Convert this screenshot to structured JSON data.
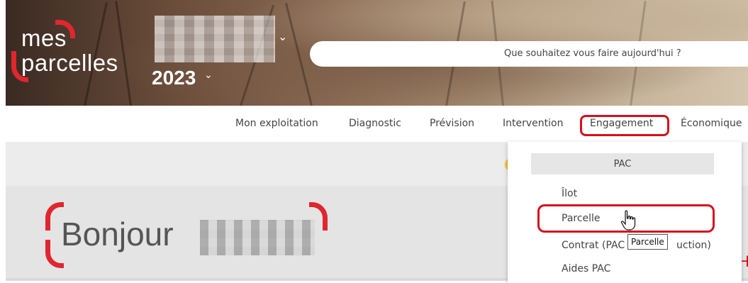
{
  "brand": {
    "line1": "mes",
    "line2": "parcelles",
    "accent": "#e0262f"
  },
  "header": {
    "farm_chevron": "⌄",
    "year": "2023",
    "year_chevron": "⌄"
  },
  "search": {
    "placeholder": "Que souhaitez vous faire aujourd'hui ?"
  },
  "nav": {
    "items": [
      "Mon exploitation",
      "Diagnostic",
      "Prévision",
      "Intervention",
      "Engagement",
      "Économique"
    ]
  },
  "dropdown": {
    "header": "PAC",
    "items": [
      "Îlot",
      "Parcelle",
      "Contrat (PAC",
      "uction)",
      "Aides PAC"
    ]
  },
  "tooltip": "Parcelle",
  "greeting": {
    "text": "Bonjour",
    "edge_letter": "H"
  },
  "icons": {
    "cursor": "hand-pointer-icon",
    "chevron": "chevron-down-icon"
  }
}
